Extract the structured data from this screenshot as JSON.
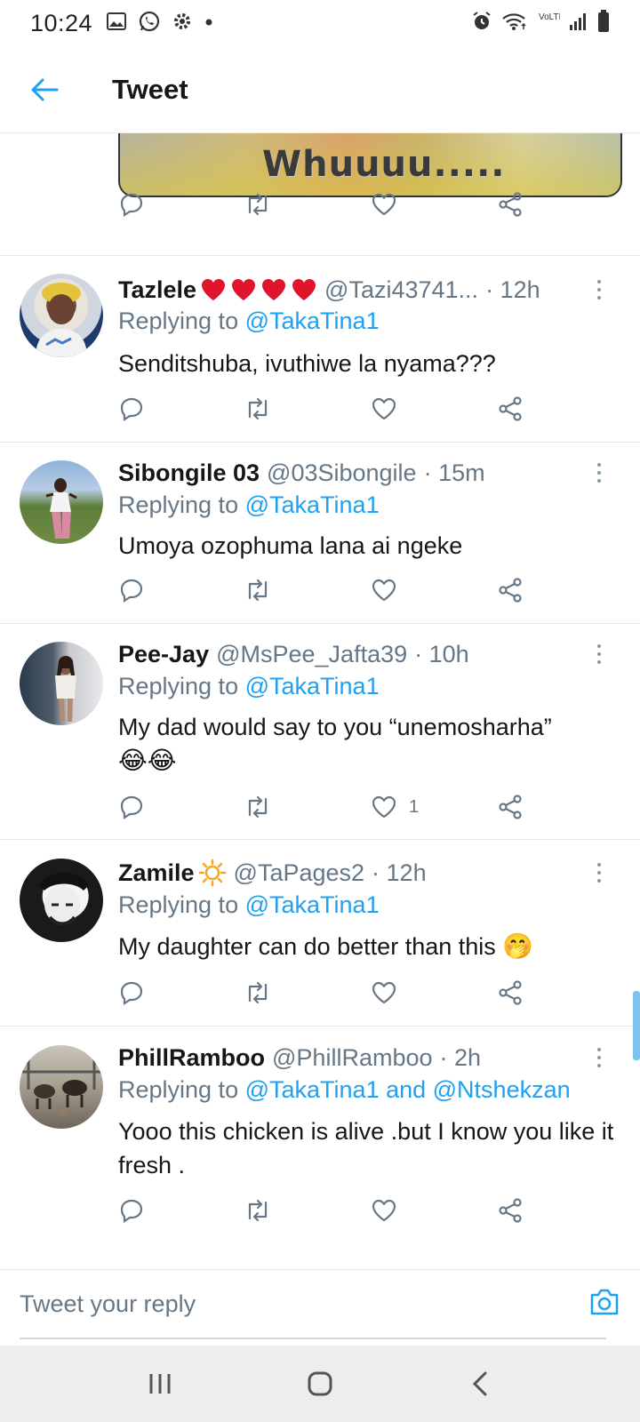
{
  "status_bar": {
    "time": "10:24",
    "left_icons": [
      "image-icon",
      "whatsapp-icon",
      "gear-icon",
      "dot-icon"
    ],
    "right_icons": [
      "alarm-icon",
      "wifi-icon",
      "volte-icon",
      "signal-icon",
      "battery-icon"
    ],
    "volte_label": "VoLTE"
  },
  "header": {
    "title": "Tweet"
  },
  "media": {
    "caption": "Whuuuu....."
  },
  "tweets": [
    {
      "name": "Tazlele",
      "name_emoji": "heart-emoji",
      "handle": "@Tazi43741...",
      "time": "· 12h",
      "replying_prefix": "Replying to",
      "replying_mentions": "@TakaTina1",
      "text": "Senditshuba, ivuthiwe la nyama???"
    },
    {
      "name": "Sibongile 03",
      "handle": "@03Sibongile",
      "time": "· 15m",
      "replying_prefix": "Replying to",
      "replying_mentions": "@TakaTina1",
      "text": "Umoya ozophuma lana ai ngeke"
    },
    {
      "name": "Pee-Jay",
      "handle": "@MsPee_Jafta39",
      "time": "· 10h",
      "replying_prefix": "Replying to",
      "replying_mentions": "@TakaTina1",
      "text": "My dad would say to you “unemosharha”",
      "text_emoji": "😂😂",
      "like_count": "1"
    },
    {
      "name": "Zamile",
      "name_emoji": "sun-emoji",
      "handle": "@TaPages2",
      "time": "· 12h",
      "replying_prefix": "Replying to",
      "replying_mentions": "@TakaTina1",
      "text": "My daughter can do better than this",
      "text_emoji": "🤭"
    },
    {
      "name": "PhillRamboo",
      "handle": "@PhillRamboo",
      "time": "· 2h",
      "replying_prefix": "Replying to",
      "replying_mentions": "@TakaTina1 and @Ntshekzan",
      "text": "Yooo this chicken is alive .but I know you like it fresh ."
    }
  ],
  "reply_bar": {
    "placeholder": "Tweet your reply"
  },
  "nav": [
    "recents-button",
    "home-button",
    "back-button"
  ],
  "colors": {
    "accent": "#1da1f2",
    "muted": "#657786",
    "text": "#14171a"
  }
}
